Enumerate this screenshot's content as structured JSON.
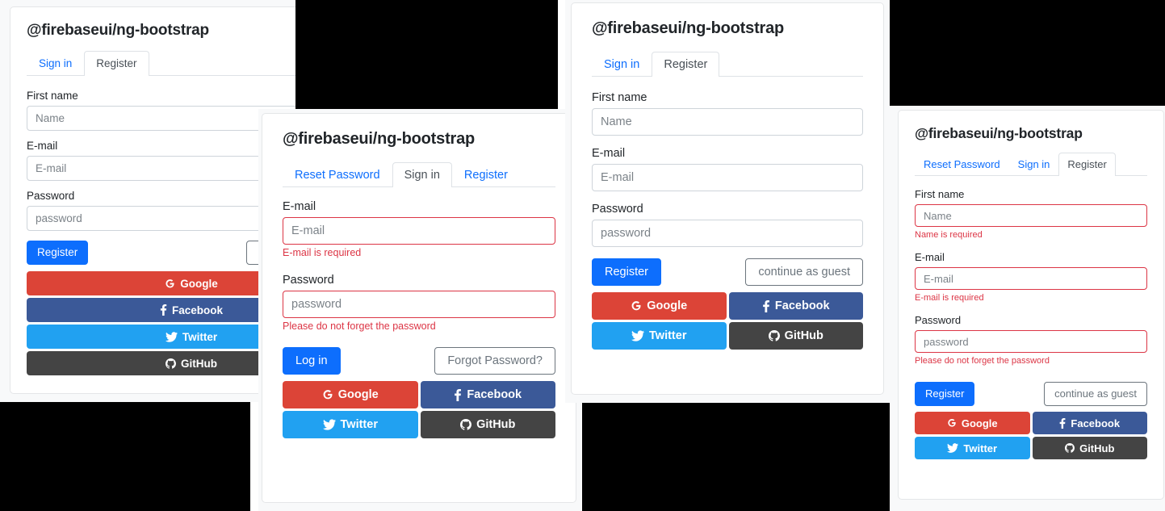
{
  "app": {
    "brand": "@firebaseui/ng-bootstrap",
    "background": "#f8f9fa",
    "accent": "#0d6efd",
    "error_color": "#dc3545"
  },
  "labels": {
    "first_name": "First name",
    "email": "E-mail",
    "password": "Password"
  },
  "placeholders": {
    "name": "Name",
    "email": "E-mail",
    "password": "password"
  },
  "errors": {
    "name_required": "Name is required",
    "email_required": "E-mail is required",
    "password_forget": "Please do not forget the password"
  },
  "tabs": {
    "reset_password": "Reset Password",
    "sign_in": "Sign in",
    "register": "Register"
  },
  "buttons": {
    "register": "Register",
    "log_in": "Log in",
    "continue_as_guest": "continue as guest",
    "forgot_password": "Forgot Password?"
  },
  "social": {
    "google": {
      "label": "Google",
      "color": "#dc4437",
      "icon": "google-icon"
    },
    "facebook": {
      "label": "Facebook",
      "color": "#3b5998",
      "icon": "facebook-icon"
    },
    "twitter": {
      "label": "Twitter",
      "color": "#21a1f1",
      "icon": "twitter-icon"
    },
    "github": {
      "label": "GitHub",
      "color": "#444444",
      "icon": "github-icon"
    }
  },
  "windows": [
    {
      "id": "window-register-narrow",
      "active_tab": "Register",
      "tabs": [
        "Sign in",
        "Register"
      ],
      "social_layout": "stacked"
    },
    {
      "id": "window-signin-validation",
      "active_tab": "Sign in",
      "tabs": [
        "Reset Password",
        "Sign in",
        "Register"
      ],
      "social_layout": "grid"
    },
    {
      "id": "window-register-clean",
      "active_tab": "Register",
      "tabs": [
        "Sign in",
        "Register"
      ],
      "social_layout": "grid"
    },
    {
      "id": "window-register-validation",
      "active_tab": "Register",
      "tabs": [
        "Reset Password",
        "Sign in",
        "Register"
      ],
      "social_layout": "grid"
    }
  ]
}
